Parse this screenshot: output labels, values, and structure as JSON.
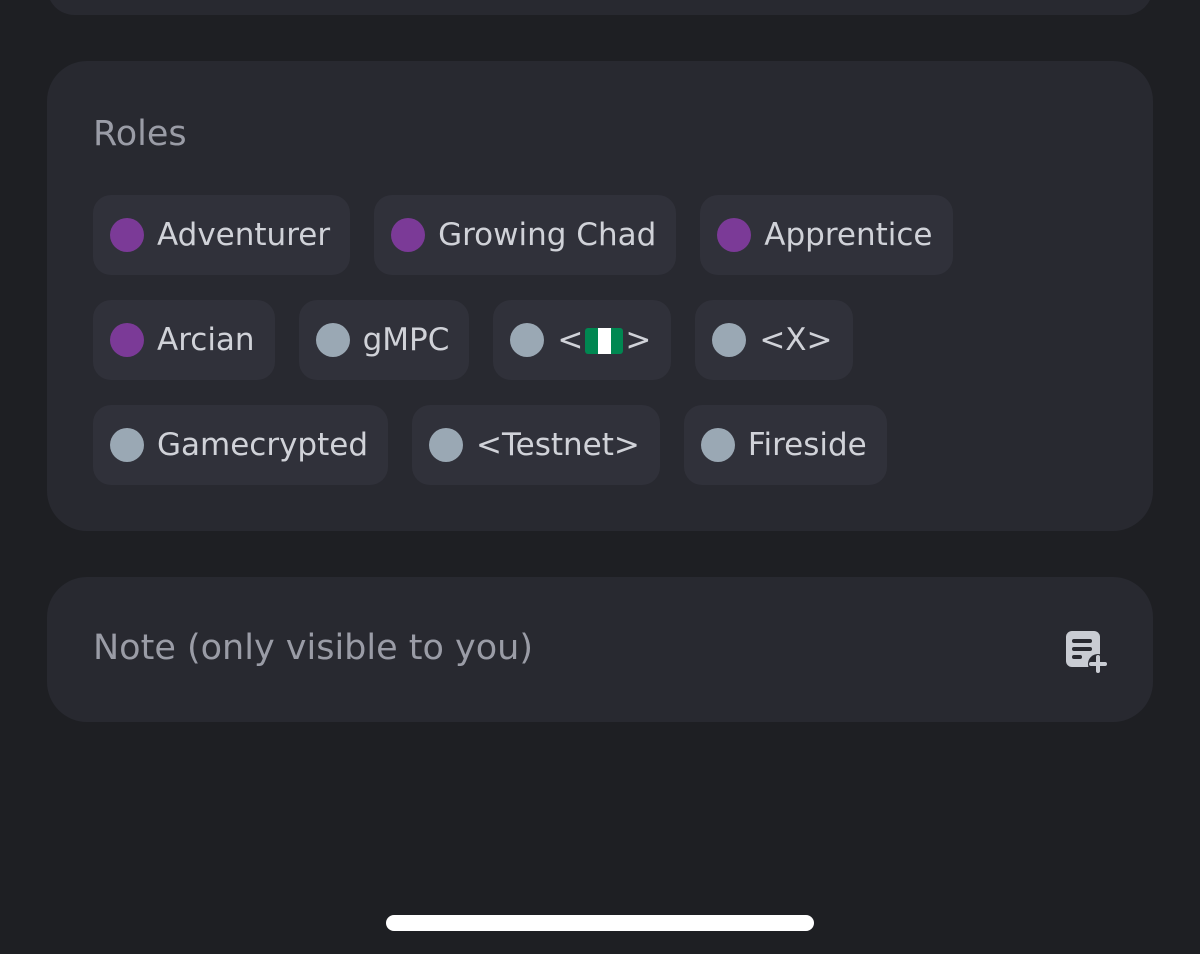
{
  "roles_section": {
    "title": "Roles",
    "rows": [
      [
        {
          "label": "Adventurer",
          "color": "#7b3a97"
        },
        {
          "label": "Growing Chad",
          "color": "#7b3a97"
        },
        {
          "label": "Apprentice",
          "color": "#7b3a97"
        }
      ],
      [
        {
          "label": "Arcian",
          "color": "#7b3a97"
        },
        {
          "label": "gMPC",
          "color": "#9aa8b4"
        },
        {
          "label_prefix": "<",
          "label_suffix": ">",
          "flag": "nigeria-flag",
          "color": "#9aa8b4"
        },
        {
          "label": "<X>",
          "color": "#9aa8b4"
        }
      ],
      [
        {
          "label": "Gamecrypted",
          "color": "#9aa8b4"
        },
        {
          "label": "<Testnet>",
          "color": "#9aa8b4"
        },
        {
          "label": "Fireside",
          "color": "#9aa8b4"
        }
      ]
    ]
  },
  "note": {
    "placeholder": "Note (only visible to you)",
    "icon": "add-note-icon"
  },
  "colors": {
    "background": "#1e1f23",
    "card": "#282930",
    "chip": "#30313a",
    "role_purple": "#7b3a97",
    "role_gray": "#9aa8b4",
    "flag_green": "#008751",
    "flag_white": "#ffffff"
  }
}
